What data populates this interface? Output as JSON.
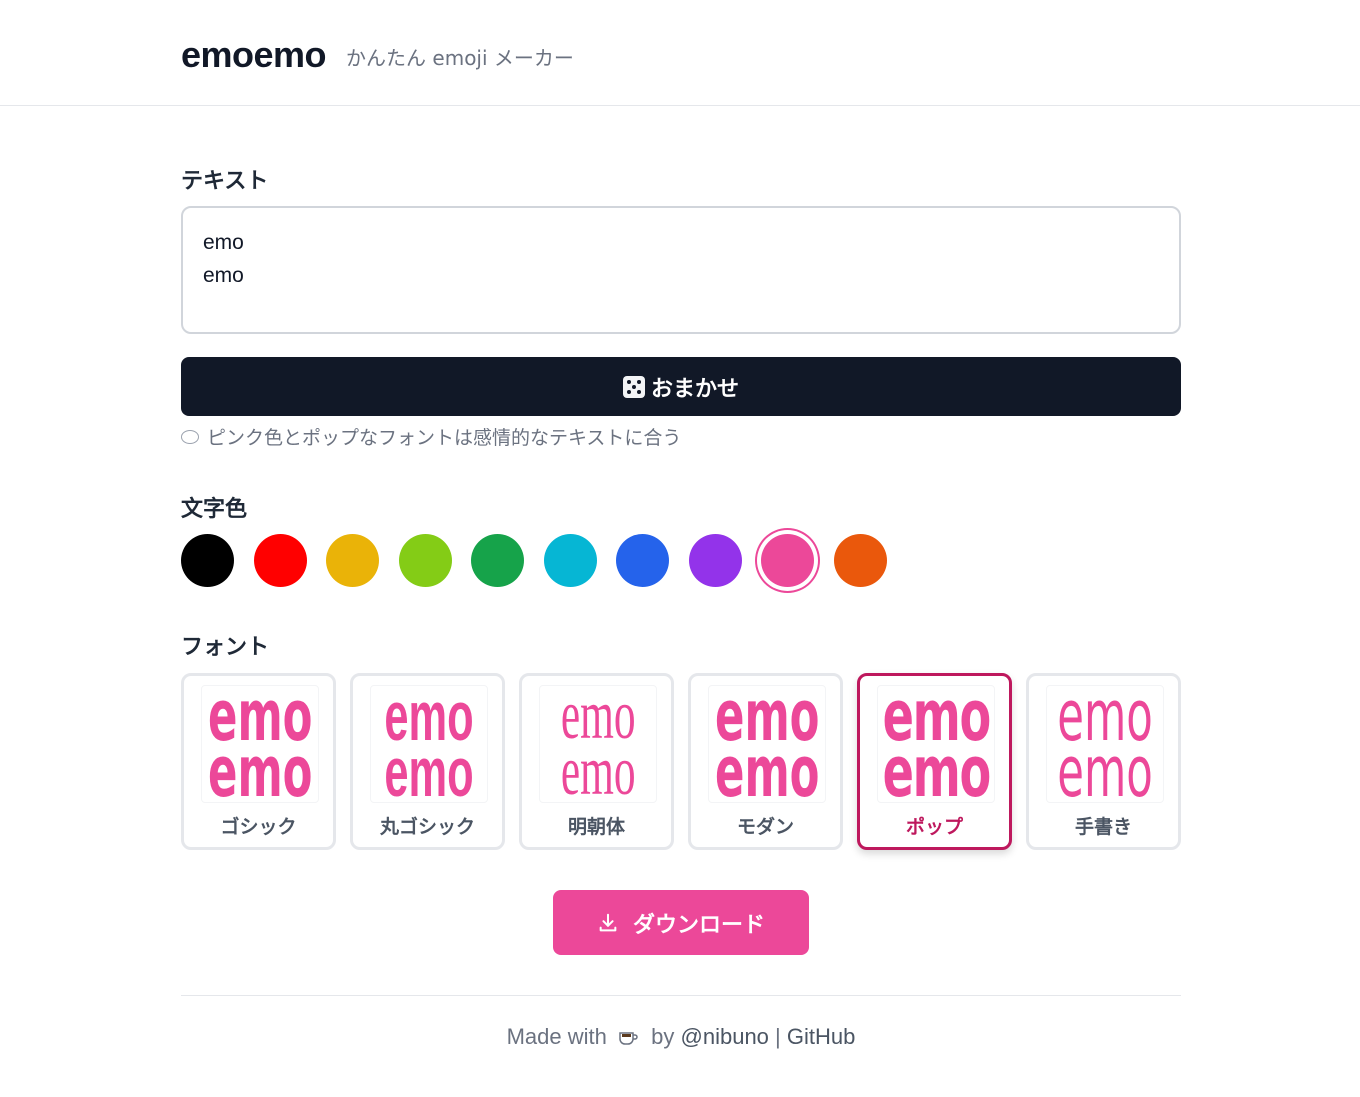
{
  "header": {
    "title": "emoemo",
    "subtitle": "かんたん emoji メーカー"
  },
  "text_section": {
    "label": "テキスト",
    "value": "emo\nemo"
  },
  "random_button": {
    "label": "おまかせ",
    "icon": "dice-icon"
  },
  "hint": {
    "icon": "speech-bubble-icon",
    "text": "ピンク色とポップなフォントは感情的なテキストに合う"
  },
  "color_section": {
    "label": "文字色",
    "colors": [
      "#000000",
      "#ff0000",
      "#eab308",
      "#84cc16",
      "#16a34a",
      "#06b6d4",
      "#2563eb",
      "#9333ea",
      "#ec4899",
      "#ea580c"
    ],
    "selected_index": 8
  },
  "font_section": {
    "label": "フォント",
    "preview_line1": "emo",
    "preview_line2": "emo",
    "fonts": [
      {
        "name": "ゴシック"
      },
      {
        "name": "丸ゴシック"
      },
      {
        "name": "明朝体"
      },
      {
        "name": "モダン"
      },
      {
        "name": "ポップ"
      },
      {
        "name": "手書き"
      }
    ],
    "selected_index": 4,
    "preview_color": "#ec4899"
  },
  "download_button": {
    "label": "ダウンロード",
    "icon": "download-icon"
  },
  "footer": {
    "made_with": "Made with",
    "icon": "coffee-icon",
    "by": "by",
    "author": "@nibuno",
    "separator": "|",
    "github": "GitHub"
  }
}
